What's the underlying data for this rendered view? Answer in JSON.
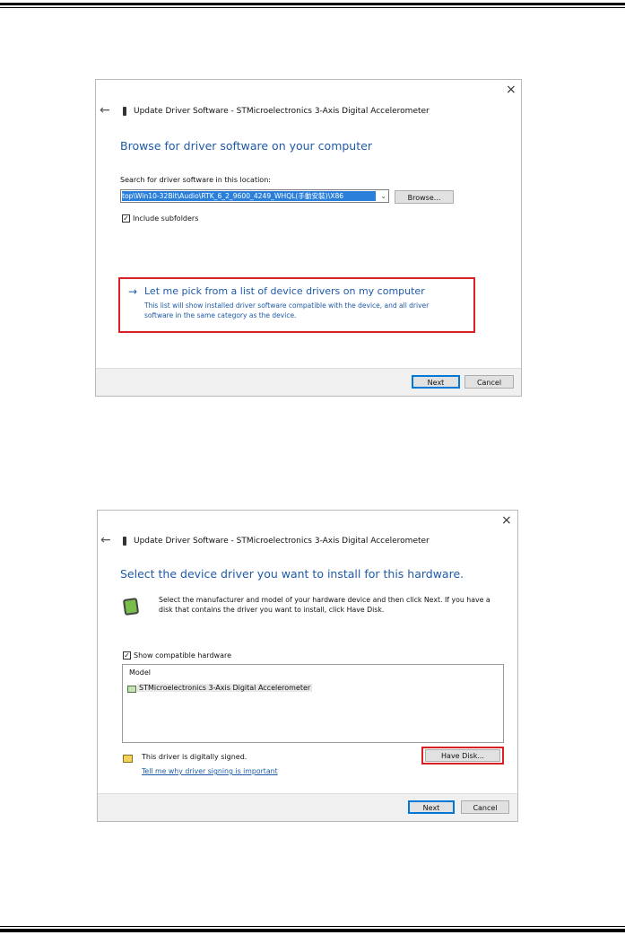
{
  "dialog1": {
    "title": "Update Driver Software - STMicroelectronics 3-Axis Digital Accelerometer",
    "heading": "Browse for driver software on your computer",
    "search_label": "Search for driver software in this location:",
    "path_value": "top\\Win10-32Bit\\Audio\\RTK_6_2_9600_4249_WHQL(手動安裝)\\X86",
    "browse_label": "Browse...",
    "include_subfolders_label": "Include subfolders",
    "include_subfolders_checked": true,
    "pick_link_title": "Let me pick from a list of device drivers on my computer",
    "pick_link_desc_1": "This list will show installed driver software compatible with the device, and all driver",
    "pick_link_desc_2": "software in the same category as the device.",
    "next_label": "Next",
    "cancel_label": "Cancel"
  },
  "dialog2": {
    "title": "Update Driver Software - STMicroelectronics 3-Axis Digital Accelerometer",
    "heading": "Select the device driver you want to install for this hardware.",
    "instruction_1": "Select the manufacturer and model of your hardware device and then click Next. If you have a",
    "instruction_2": "disk that contains the driver you want to install, click Have Disk.",
    "show_compatible_label": "Show compatible hardware",
    "show_compatible_checked": true,
    "model_header": "Model",
    "models": [
      "STMicroelectronics 3-Axis Digital Accelerometer"
    ],
    "signed_text": "This driver is digitally signed.",
    "signing_link": "Tell me why driver signing is important",
    "have_disk_label": "Have Disk...",
    "next_label": "Next",
    "cancel_label": "Cancel"
  },
  "icons": {
    "close": "×",
    "back": "←",
    "link_arrow": "→",
    "check": "✓",
    "chevron": "⌄"
  },
  "colors": {
    "link_blue": "#1f5aa8",
    "highlight_red": "#d92027",
    "selection_blue": "#2a7fdb"
  }
}
